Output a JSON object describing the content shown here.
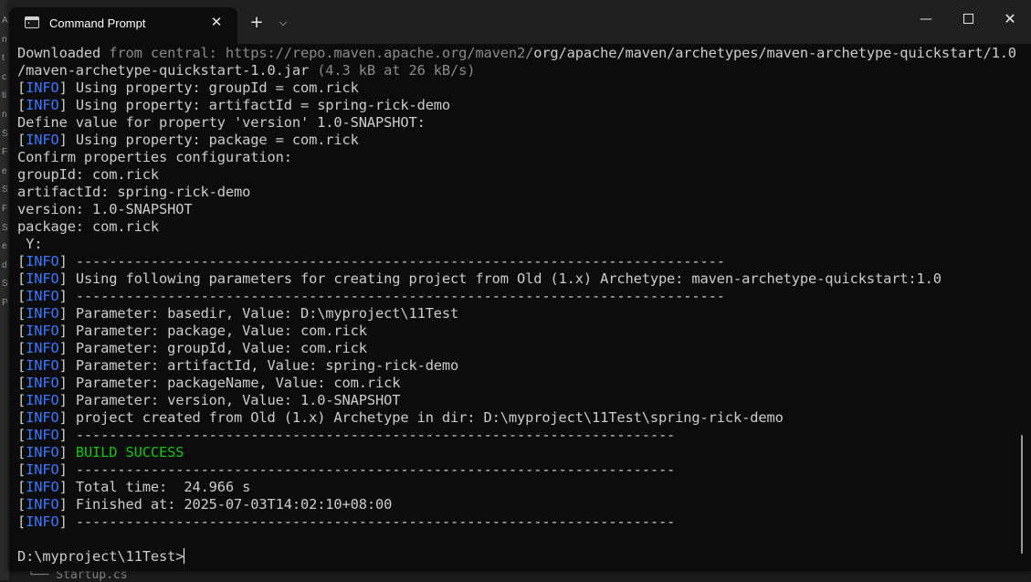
{
  "background": {
    "left_fragments": [
      "A",
      "n",
      "t",
      "c",
      "ti",
      "n",
      "S",
      "F",
      "e",
      "S",
      "F",
      "S",
      "e",
      "d",
      "S",
      "P"
    ],
    "bottom_text": "└── Startup.cs"
  },
  "window": {
    "tab": {
      "icon": "command-prompt-icon",
      "title": "Command Prompt",
      "close_glyph": "✕"
    },
    "new_tab_glyph": "+",
    "dropdown_glyph": "⌵",
    "controls": {
      "minimize_glyph": "—",
      "close_glyph": "✕"
    }
  },
  "colors": {
    "info_tag": "#3b78ff",
    "success": "#16c60c",
    "dim": "#8a8a8a",
    "text": "#cccccc",
    "terminal_bg": "#0c0c0c"
  },
  "terminal": {
    "lines": [
      [
        {
          "t": "Downloaded ",
          "c": "white"
        },
        {
          "t": "from",
          "c": "dim"
        },
        {
          "t": " central: https://repo.maven.apache.org/maven2/",
          "c": "dim"
        },
        {
          "t": "org/apache/maven/archetypes/maven-archetype-quickstart/1.0",
          "c": "white"
        }
      ],
      [
        {
          "t": "/maven-archetype-quickstart-1.0.jar ",
          "c": "white"
        },
        {
          "t": "(4.3 kB at 26 kB/s)",
          "c": "dim"
        }
      ],
      [
        {
          "t": "[",
          "c": "white"
        },
        {
          "t": "INFO",
          "c": "blue"
        },
        {
          "t": "] Using property: groupId = com.rick",
          "c": "white"
        }
      ],
      [
        {
          "t": "[",
          "c": "white"
        },
        {
          "t": "INFO",
          "c": "blue"
        },
        {
          "t": "] Using property: artifactId = spring-rick-demo",
          "c": "white"
        }
      ],
      [
        {
          "t": "Define value for property 'version' 1.0-SNAPSHOT:",
          "c": "white"
        }
      ],
      [
        {
          "t": "[",
          "c": "white"
        },
        {
          "t": "INFO",
          "c": "blue"
        },
        {
          "t": "] Using property: package = com.rick",
          "c": "white"
        }
      ],
      [
        {
          "t": "Confirm properties configuration:",
          "c": "white"
        }
      ],
      [
        {
          "t": "groupId: com.rick",
          "c": "white"
        }
      ],
      [
        {
          "t": "artifactId: spring-rick-demo",
          "c": "white"
        }
      ],
      [
        {
          "t": "version: 1.0-SNAPSHOT",
          "c": "white"
        }
      ],
      [
        {
          "t": "package: com.rick",
          "c": "white"
        }
      ],
      [
        {
          "t": " Y:",
          "c": "white"
        }
      ],
      [
        {
          "t": "[",
          "c": "white"
        },
        {
          "t": "INFO",
          "c": "blue"
        },
        {
          "t": "] ------------------------------------------------------------------------------",
          "c": "white"
        }
      ],
      [
        {
          "t": "[",
          "c": "white"
        },
        {
          "t": "INFO",
          "c": "blue"
        },
        {
          "t": "] Using following parameters for creating project from Old (1.x) Archetype: maven-archetype-quickstart:1.0",
          "c": "white"
        }
      ],
      [
        {
          "t": "[",
          "c": "white"
        },
        {
          "t": "INFO",
          "c": "blue"
        },
        {
          "t": "] ------------------------------------------------------------------------------",
          "c": "white"
        }
      ],
      [
        {
          "t": "[",
          "c": "white"
        },
        {
          "t": "INFO",
          "c": "blue"
        },
        {
          "t": "] Parameter: basedir, Value: D:\\myproject\\11Test",
          "c": "white"
        }
      ],
      [
        {
          "t": "[",
          "c": "white"
        },
        {
          "t": "INFO",
          "c": "blue"
        },
        {
          "t": "] Parameter: package, Value: com.rick",
          "c": "white"
        }
      ],
      [
        {
          "t": "[",
          "c": "white"
        },
        {
          "t": "INFO",
          "c": "blue"
        },
        {
          "t": "] Parameter: groupId, Value: com.rick",
          "c": "white"
        }
      ],
      [
        {
          "t": "[",
          "c": "white"
        },
        {
          "t": "INFO",
          "c": "blue"
        },
        {
          "t": "] Parameter: artifactId, Value: spring-rick-demo",
          "c": "white"
        }
      ],
      [
        {
          "t": "[",
          "c": "white"
        },
        {
          "t": "INFO",
          "c": "blue"
        },
        {
          "t": "] Parameter: packageName, Value: com.rick",
          "c": "white"
        }
      ],
      [
        {
          "t": "[",
          "c": "white"
        },
        {
          "t": "INFO",
          "c": "blue"
        },
        {
          "t": "] Parameter: version, Value: 1.0-SNAPSHOT",
          "c": "white"
        }
      ],
      [
        {
          "t": "[",
          "c": "white"
        },
        {
          "t": "INFO",
          "c": "blue"
        },
        {
          "t": "] project created from Old (1.x) Archetype in dir: D:\\myproject\\11Test\\spring-rick-demo",
          "c": "white"
        }
      ],
      [
        {
          "t": "[",
          "c": "white"
        },
        {
          "t": "INFO",
          "c": "blue"
        },
        {
          "t": "] ------------------------------------------------------------------------",
          "c": "white"
        }
      ],
      [
        {
          "t": "[",
          "c": "white"
        },
        {
          "t": "INFO",
          "c": "blue"
        },
        {
          "t": "] ",
          "c": "white"
        },
        {
          "t": "BUILD SUCCESS",
          "c": "green"
        }
      ],
      [
        {
          "t": "[",
          "c": "white"
        },
        {
          "t": "INFO",
          "c": "blue"
        },
        {
          "t": "] ------------------------------------------------------------------------",
          "c": "white"
        }
      ],
      [
        {
          "t": "[",
          "c": "white"
        },
        {
          "t": "INFO",
          "c": "blue"
        },
        {
          "t": "] Total time:  24.966 s",
          "c": "white"
        }
      ],
      [
        {
          "t": "[",
          "c": "white"
        },
        {
          "t": "INFO",
          "c": "blue"
        },
        {
          "t": "] Finished at: 2025-07-03T14:02:10+08:00",
          "c": "white"
        }
      ],
      [
        {
          "t": "[",
          "c": "white"
        },
        {
          "t": "INFO",
          "c": "blue"
        },
        {
          "t": "] ------------------------------------------------------------------------",
          "c": "white"
        }
      ],
      [
        {
          "t": "",
          "c": "white"
        }
      ],
      [
        {
          "t": "D:\\myproject\\11Test>",
          "c": "white"
        }
      ]
    ]
  }
}
